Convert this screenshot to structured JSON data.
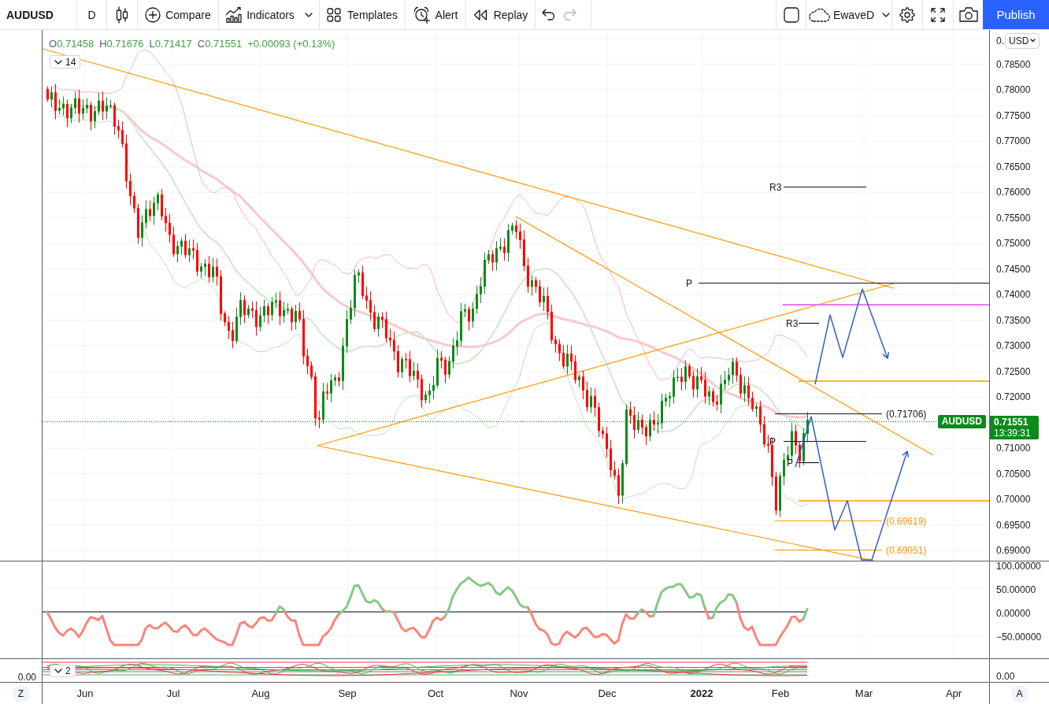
{
  "toolbar": {
    "symbol": "AUDUSD",
    "interval": "D",
    "buttons": [
      {
        "kind": "compare",
        "label": "Compare"
      },
      {
        "kind": "indicators",
        "label": "Indicators"
      },
      {
        "kind": "templates",
        "label": "Templates"
      },
      {
        "kind": "alert",
        "label": "Alert"
      },
      {
        "kind": "replay",
        "label": "Replay"
      }
    ],
    "history": [
      {
        "kind": "undo",
        "disabled": false
      },
      {
        "kind": "redo",
        "disabled": true
      }
    ],
    "layout_name": "EwaveD",
    "publish": "Publish"
  },
  "legend": {
    "values": [
      {
        "label": "O",
        "value": "0.71458"
      },
      {
        "label": "H",
        "value": "0.71676"
      },
      {
        "label": "L",
        "value": "0.71417"
      },
      {
        "label": "C",
        "value": "0.71551"
      }
    ],
    "change": "+0.00093 (+0.13%)",
    "collapse_count": "14"
  },
  "chart": {
    "symbol_tag": "AUDUSD",
    "annotations": [
      {
        "text": "R3",
        "color": "#131722"
      },
      {
        "text": "P",
        "color": "#131722"
      },
      {
        "text": "R3",
        "color": "#131722"
      },
      {
        "text": "(0.71706)",
        "color": "#131722"
      },
      {
        "text": "P",
        "color": "#131722"
      },
      {
        "text": "P",
        "color": "#131722"
      },
      {
        "text": "(0.69619)",
        "color": "#ff9800"
      },
      {
        "text": "(0.69051)",
        "color": "#ff9800"
      }
    ]
  },
  "price_axis": {
    "partial_label": "0.",
    "currency": "USD",
    "items": [
      {
        "kind": "tick",
        "text": "0.78500"
      },
      {
        "kind": "tick",
        "text": "0.78000"
      },
      {
        "kind": "tick",
        "text": "0.77500"
      },
      {
        "kind": "tick",
        "text": "0.77000"
      },
      {
        "kind": "tick",
        "text": "0.76500"
      },
      {
        "kind": "tick",
        "text": "0.76000"
      },
      {
        "kind": "tick",
        "text": "0.75500"
      },
      {
        "kind": "tick",
        "text": "0.75000"
      },
      {
        "kind": "tick",
        "text": "0.74500"
      },
      {
        "kind": "tick",
        "text": "0.74000"
      },
      {
        "kind": "tick",
        "text": "0.73500"
      },
      {
        "kind": "tick",
        "text": "0.73000"
      },
      {
        "kind": "tick",
        "text": "0.72500"
      },
      {
        "kind": "tick",
        "text": "0.72000"
      },
      {
        "kind": "last_price",
        "price": "0.71551",
        "countdown": "13:39:31"
      },
      {
        "kind": "tick",
        "text": "0.71000"
      },
      {
        "kind": "tick",
        "text": "0.70500"
      },
      {
        "kind": "tick",
        "text": "0.70000"
      },
      {
        "kind": "tick",
        "text": "0.69500"
      },
      {
        "kind": "tick",
        "text": "0.69000"
      }
    ]
  },
  "cci_pane": {
    "ticks": [
      "100.00000",
      "50.00000",
      "0.00000",
      "−50.00000"
    ]
  },
  "oscillator_pane": {
    "collapse_count": "2",
    "left_tick": "0.00",
    "right_tick": "0.00"
  },
  "time_axis": {
    "labels": [
      {
        "text": "Jun",
        "kind": "month"
      },
      {
        "text": "Jul",
        "kind": "month"
      },
      {
        "text": "Aug",
        "kind": "month"
      },
      {
        "text": "Sep",
        "kind": "month"
      },
      {
        "text": "Oct",
        "kind": "month"
      },
      {
        "text": "Nov",
        "kind": "month"
      },
      {
        "text": "Dec",
        "kind": "month"
      },
      {
        "text": "2022",
        "kind": "year"
      },
      {
        "text": "Feb",
        "kind": "month"
      },
      {
        "text": "Mar",
        "kind": "month"
      },
      {
        "text": "Apr",
        "kind": "month"
      }
    ]
  },
  "scale_buttons": {
    "left": "Z",
    "right": "A"
  }
}
